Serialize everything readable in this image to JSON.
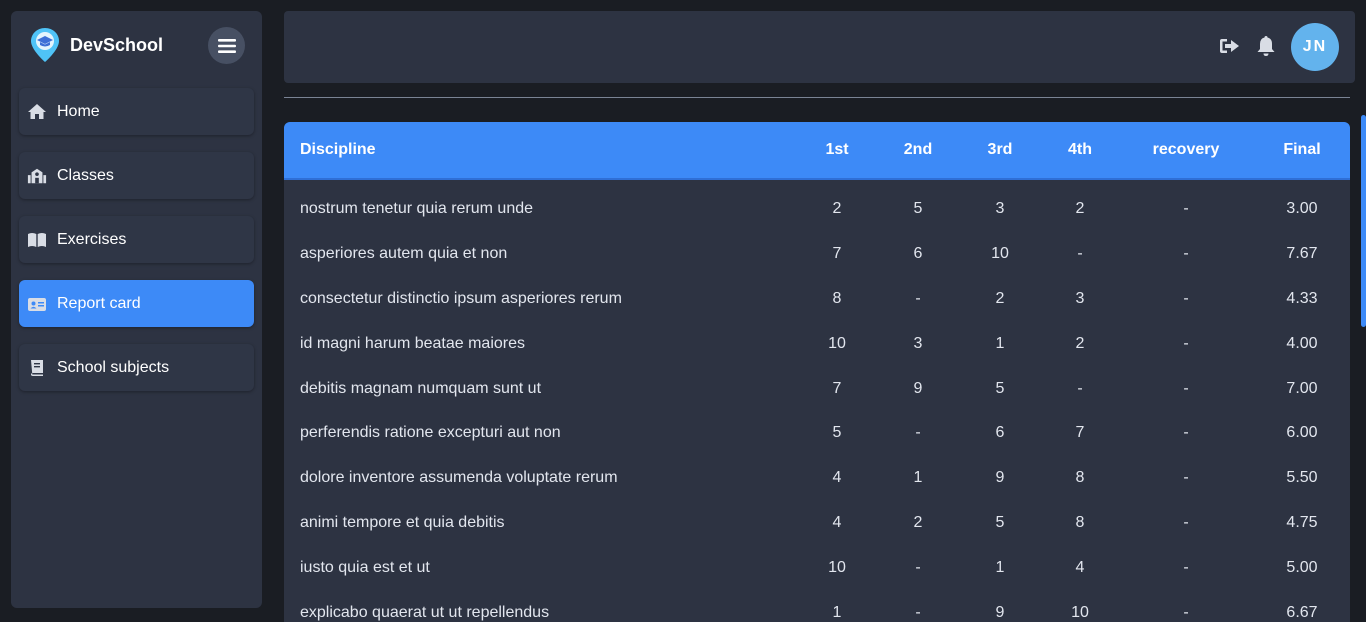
{
  "brand": {
    "name": "DevSchool"
  },
  "nav": {
    "items": [
      {
        "label": "Home",
        "icon": "home-icon"
      },
      {
        "label": "Classes",
        "icon": "school-icon"
      },
      {
        "label": "Exercises",
        "icon": "book-open-icon"
      },
      {
        "label": "Report card",
        "icon": "id-card-icon",
        "active": true
      },
      {
        "label": "School subjects",
        "icon": "book-icon"
      }
    ]
  },
  "header": {
    "avatar_initials": "JN"
  },
  "table": {
    "columns": [
      "Discipline",
      "1st",
      "2nd",
      "3rd",
      "4th",
      "recovery",
      "Final"
    ],
    "rows": [
      [
        "nostrum tenetur quia rerum unde",
        "2",
        "5",
        "3",
        "2",
        "-",
        "3.00"
      ],
      [
        "asperiores autem quia et non",
        "7",
        "6",
        "10",
        "-",
        "-",
        "7.67"
      ],
      [
        "consectetur distinctio ipsum asperiores rerum",
        "8",
        "-",
        "2",
        "3",
        "-",
        "4.33"
      ],
      [
        "id magni harum beatae maiores",
        "10",
        "3",
        "1",
        "2",
        "-",
        "4.00"
      ],
      [
        "debitis magnam numquam sunt ut",
        "7",
        "9",
        "5",
        "-",
        "-",
        "7.00"
      ],
      [
        "perferendis ratione excepturi aut non",
        "5",
        "-",
        "6",
        "7",
        "-",
        "6.00"
      ],
      [
        "dolore inventore assumenda voluptate rerum",
        "4",
        "1",
        "9",
        "8",
        "-",
        "5.50"
      ],
      [
        "animi tempore et quia debitis",
        "4",
        "2",
        "5",
        "8",
        "-",
        "4.75"
      ],
      [
        "iusto quia est et ut",
        "10",
        "-",
        "1",
        "4",
        "-",
        "5.00"
      ],
      [
        "explicabo quaerat ut ut repellendus",
        "1",
        "-",
        "9",
        "10",
        "-",
        "6.67"
      ]
    ]
  },
  "colors": {
    "accent": "#3d8af7",
    "sidebar_bg": "#2d3342",
    "page_bg": "#1a1d23",
    "avatar_bg": "#63b3ed"
  }
}
